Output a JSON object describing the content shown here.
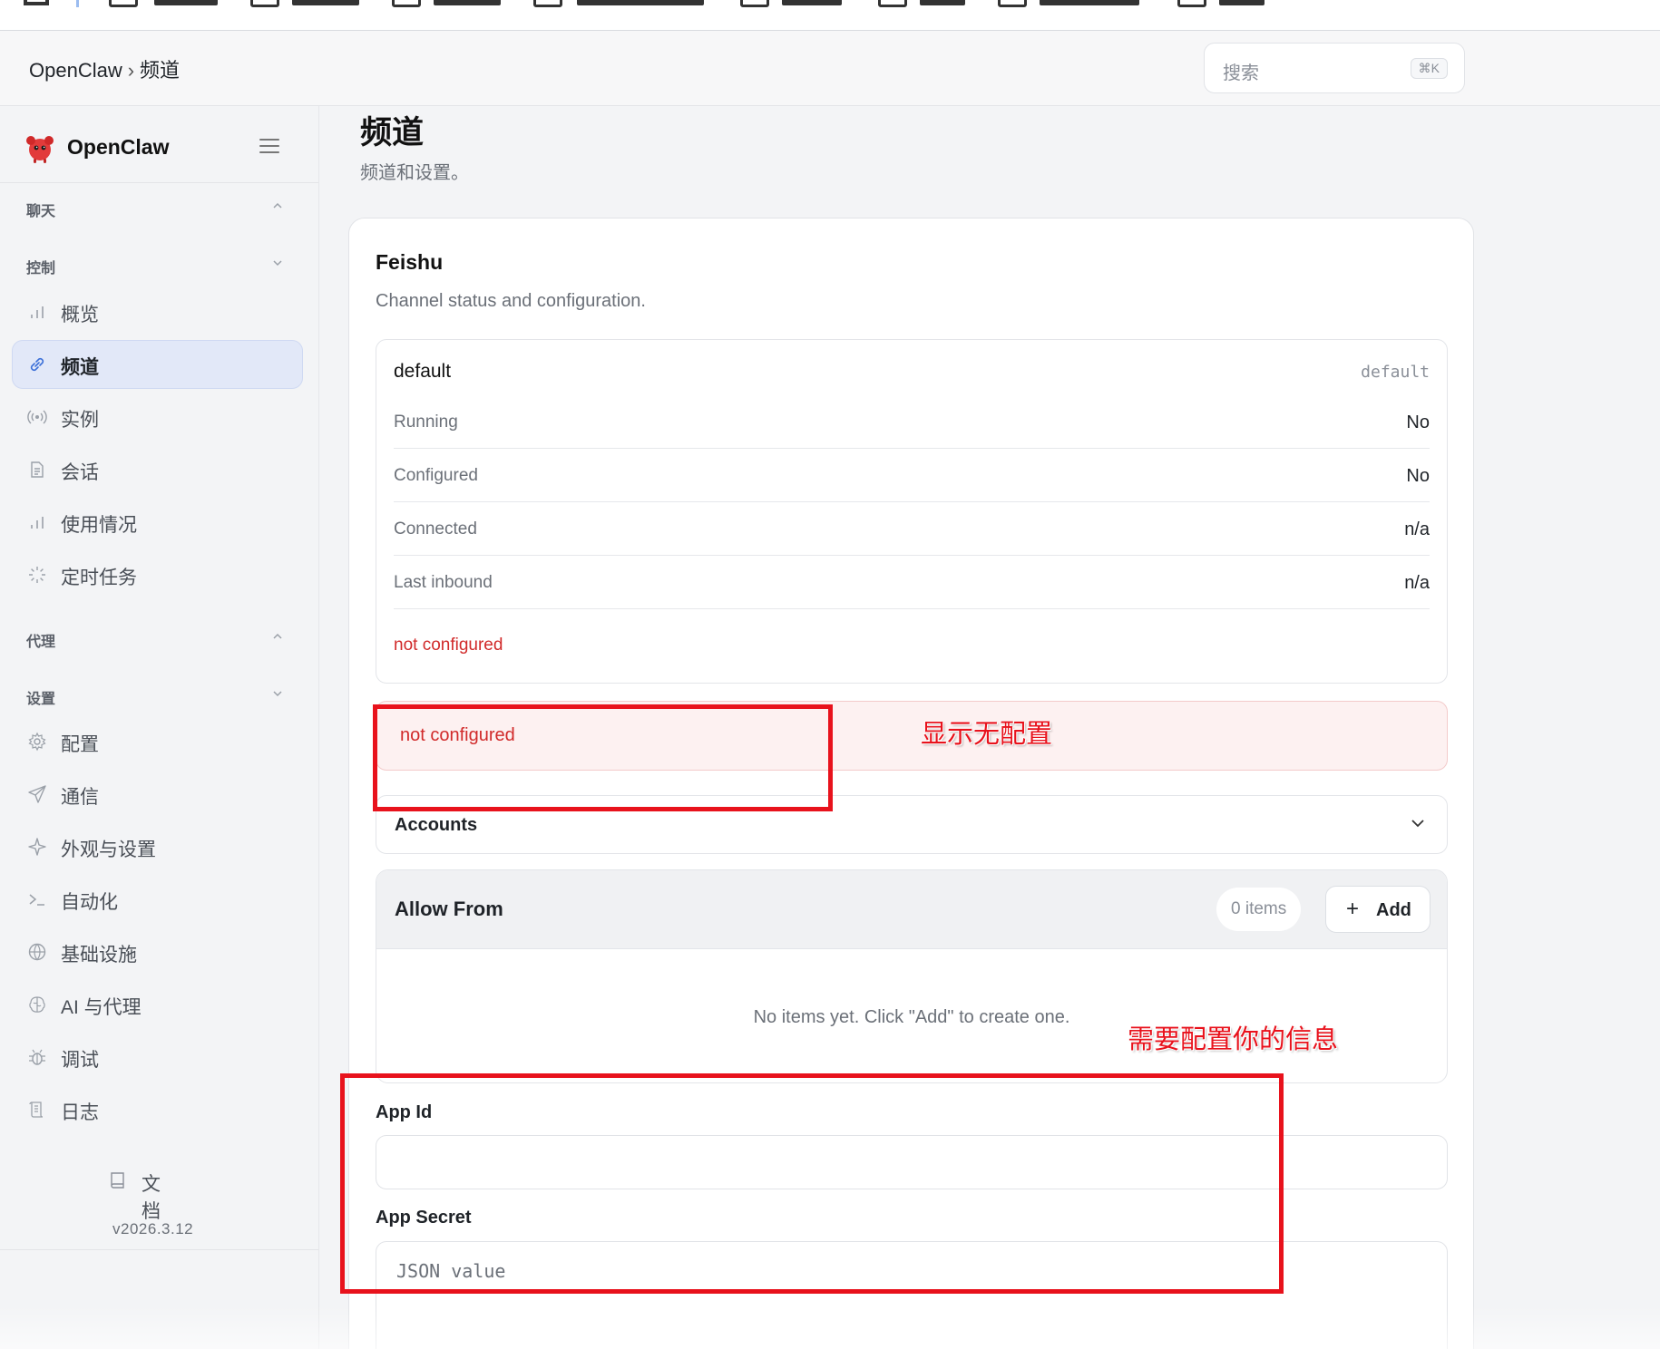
{
  "header": {
    "breadcrumb_root": "OpenClaw",
    "breadcrumb_sep": "›",
    "breadcrumb_current": "频道",
    "search_placeholder": "搜索",
    "search_shortcut": "⌘K"
  },
  "sidebar": {
    "brand": "OpenClaw",
    "sections": {
      "chat": "聊天",
      "control": "控制",
      "agent": "代理",
      "settings": "设置"
    },
    "control_items": [
      {
        "label": "概览",
        "icon": "bar-chart-icon"
      },
      {
        "label": "频道",
        "icon": "link-icon",
        "active": true
      },
      {
        "label": "实例",
        "icon": "radio-icon"
      },
      {
        "label": "会话",
        "icon": "document-icon"
      },
      {
        "label": "使用情况",
        "icon": "bar-chart-icon"
      },
      {
        "label": "定时任务",
        "icon": "loader-icon"
      }
    ],
    "settings_items": [
      {
        "label": "配置",
        "icon": "gear-icon"
      },
      {
        "label": "通信",
        "icon": "send-icon"
      },
      {
        "label": "外观与设置",
        "icon": "sparkle-icon"
      },
      {
        "label": "自动化",
        "icon": "terminal-icon"
      },
      {
        "label": "基础设施",
        "icon": "globe-icon"
      },
      {
        "label": "AI 与代理",
        "icon": "brain-icon"
      },
      {
        "label": "调试",
        "icon": "bug-icon"
      },
      {
        "label": "日志",
        "icon": "scroll-icon"
      }
    ],
    "docs_label": "文档",
    "version": "v2026.3.12"
  },
  "main": {
    "title": "频道",
    "subtitle": "频道和设置。",
    "card": {
      "title": "Feishu",
      "subtitle": "Channel status and configuration.",
      "account": {
        "name": "default",
        "tag": "default",
        "rows": [
          {
            "key": "Running",
            "value": "No"
          },
          {
            "key": "Configured",
            "value": "No"
          },
          {
            "key": "Connected",
            "value": "n/a"
          },
          {
            "key": "Last inbound",
            "value": "n/a"
          }
        ],
        "error": "not configured"
      },
      "alert": "not configured",
      "accounts_label": "Accounts",
      "allow_from": {
        "title": "Allow From",
        "count": "0 items",
        "add_label": "Add",
        "empty": "No items yet. Click \"Add\" to create one."
      },
      "app_id_label": "App Id",
      "app_id_value": "",
      "app_secret_label": "App Secret",
      "app_secret_placeholder": "JSON value"
    }
  },
  "annotations": {
    "no_config": "显示无配置",
    "need_config": "需要配置你的信息"
  },
  "colors": {
    "accent": "#3b6fd8",
    "error": "#d12a2a",
    "annotation": "#e8121c"
  }
}
